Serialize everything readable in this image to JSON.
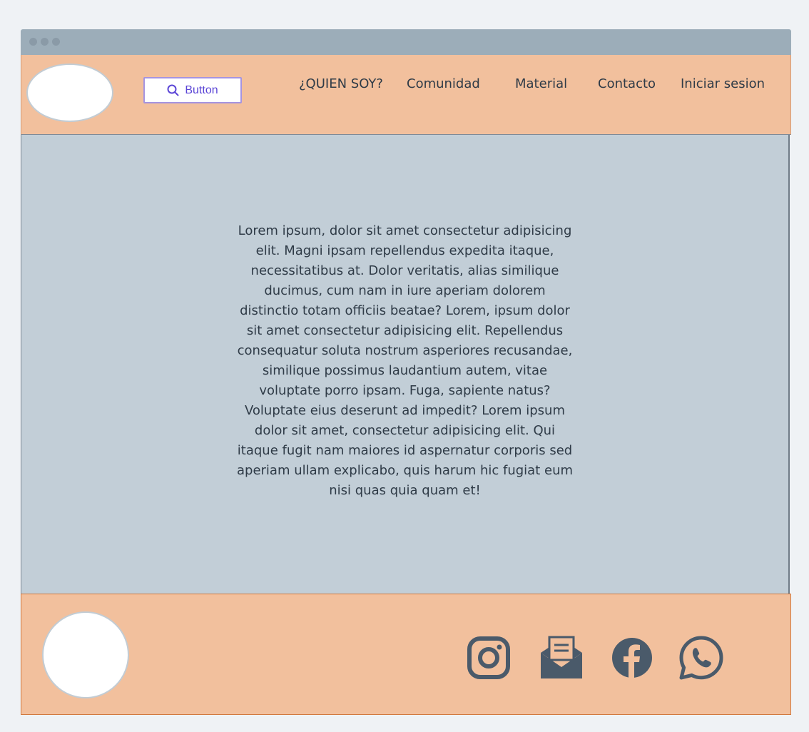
{
  "header": {
    "search_button_label": "Button",
    "nav": [
      {
        "label": "¿QUIEN SOY?"
      },
      {
        "label": "Comunidad"
      },
      {
        "label": "Material"
      },
      {
        "label": "Contacto"
      },
      {
        "label": "Iniciar sesion"
      }
    ]
  },
  "main": {
    "body_text": "Lorem ipsum, dolor sit amet consectetur adipisicing elit. Magni ipsam repellendus expedita itaque, necessitatibus at. Dolor veritatis, alias similique ducimus, cum nam in iure aperiam dolorem distinctio totam officiis beatae? Lorem, ipsum dolor sit amet consectetur adipisicing elit. Repellendus consequatur soluta nostrum asperiores recusandae, similique possimus laudantium autem, vitae voluptate porro ipsam. Fuga, sapiente natus? Voluptate eius deserunt ad impedit? Lorem ipsum dolor sit amet, consectetur adipisicing elit. Qui itaque fugit nam maiores id aspernatur corporis sed aperiam ullam explicabo, quis harum hic fugiat eum nisi quas quia quam et!"
  },
  "footer": {
    "social_icons": [
      "instagram-icon",
      "mail-icon",
      "facebook-icon",
      "whatsapp-icon"
    ]
  },
  "colors": {
    "header_bg": "#f2c09d",
    "main_bg": "#c2ced7",
    "titlebar_bg": "#9cadb9",
    "icon_color": "#4a5a6a",
    "button_accent": "#5b45d6"
  }
}
